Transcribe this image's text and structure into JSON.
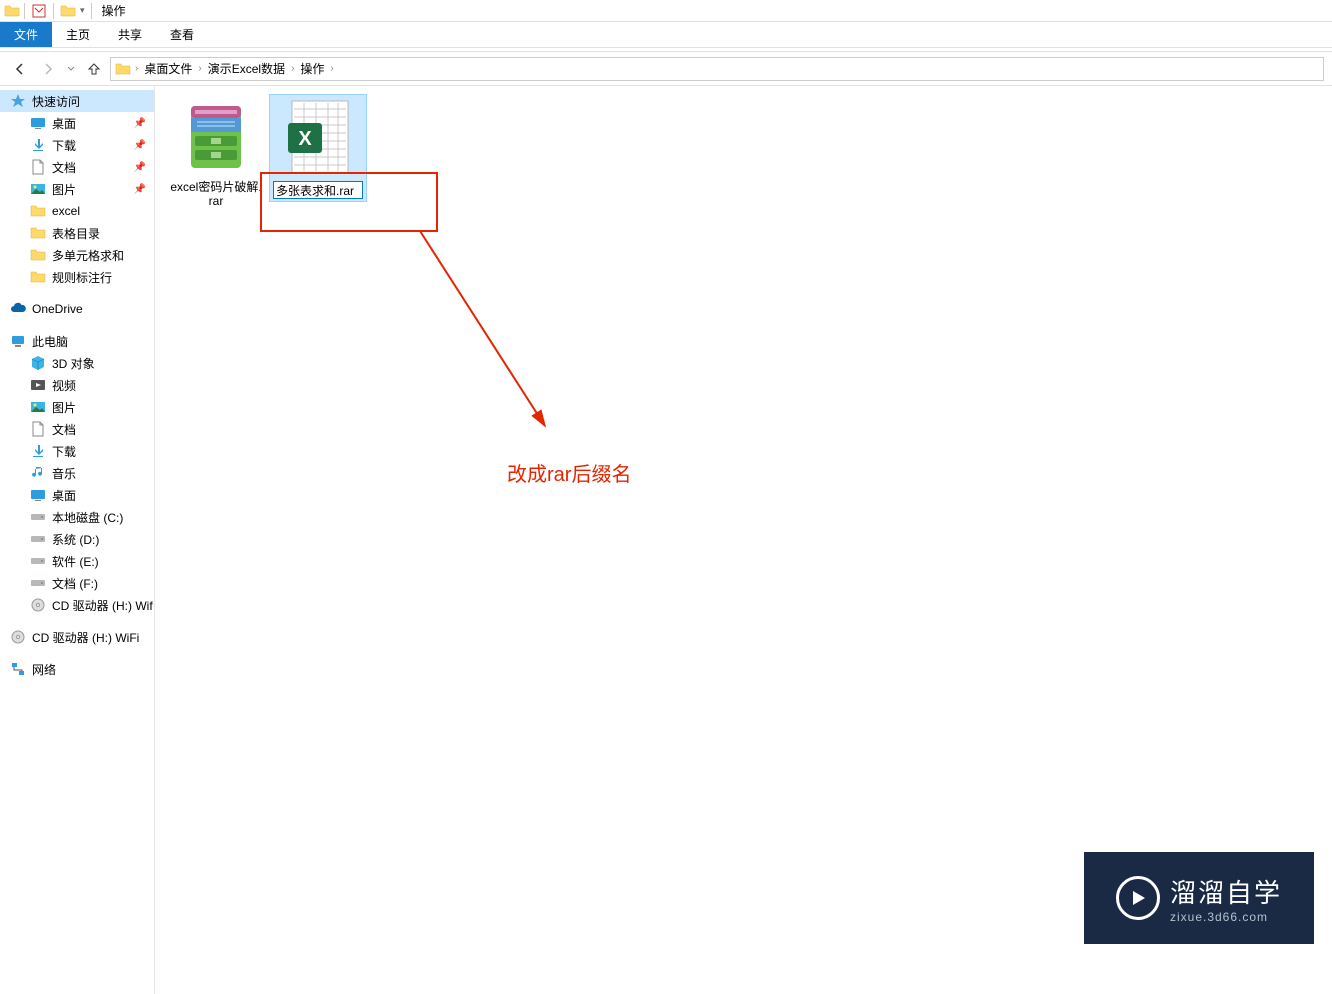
{
  "window": {
    "title": "操作"
  },
  "ribbon": {
    "file": "文件",
    "home": "主页",
    "share": "共享",
    "view": "查看"
  },
  "breadcrumb": {
    "items": [
      "桌面文件",
      "演示Excel数据",
      "操作"
    ]
  },
  "sidebar": {
    "quick_access": "快速访问",
    "desktop": "桌面",
    "downloads": "下载",
    "documents": "文档",
    "pictures": "图片",
    "excel": "excel",
    "table_dir": "表格目录",
    "multi_cell_sum": "多单元格求和",
    "rule_annot": "规则标注行",
    "onedrive": "OneDrive",
    "this_pc": "此电脑",
    "objects_3d": "3D 对象",
    "videos": "视频",
    "pictures2": "图片",
    "documents2": "文档",
    "downloads2": "下载",
    "music": "音乐",
    "desktop2": "桌面",
    "local_c": "本地磁盘 (C:)",
    "system_d": "系统 (D:)",
    "software_e": "软件 (E:)",
    "docs_f": "文档 (F:)",
    "cd_h": "CD 驱动器 (H:) Wif",
    "cd_h2": "CD 驱动器 (H:) WiFi",
    "network": "网络"
  },
  "files": {
    "item1": {
      "label": "excel密码片破解.rar"
    },
    "item2": {
      "rename_value": "多张表求和.rar"
    }
  },
  "annotation": {
    "text": "改成rar后缀名"
  },
  "watermark": {
    "main": "溜溜自学",
    "sub": "zixue.3d66.com"
  }
}
